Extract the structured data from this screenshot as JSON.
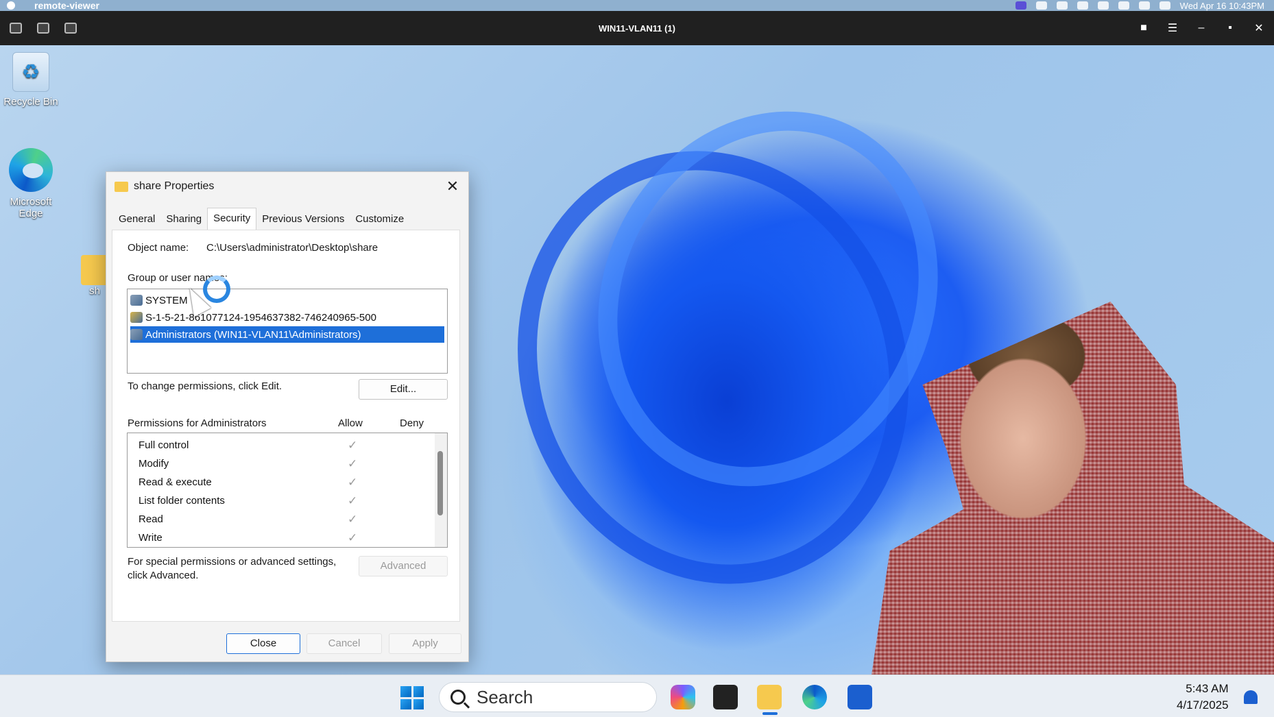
{
  "mac_bar": {
    "app_name": "remote-viewer",
    "datetime": "Wed Apr 16  10:43PM"
  },
  "viewer": {
    "title": "WIN11-VLAN11 (1)"
  },
  "desktop": {
    "icons": [
      {
        "label": "Recycle Bin"
      },
      {
        "label": "Microsoft Edge"
      },
      {
        "label": "sh"
      }
    ]
  },
  "dialog": {
    "title": "share Properties",
    "tabs": [
      "General",
      "Sharing",
      "Security",
      "Previous Versions",
      "Customize"
    ],
    "active_tab": "Security",
    "object_name_label": "Object name:",
    "object_name_value": "C:\\Users\\administrator\\Desktop\\share",
    "group_label": "Group or user names:",
    "users": [
      {
        "name": "SYSTEM",
        "selected": false
      },
      {
        "name": "S-1-5-21-861077124-1954637382-746240965-500",
        "selected": false
      },
      {
        "name": "Administrators (WIN11-VLAN11\\Administrators)",
        "selected": true
      }
    ],
    "change_text": "To change permissions, click Edit.",
    "edit_button": "Edit...",
    "permissions_for": "Permissions for Administrators",
    "allow_header": "Allow",
    "deny_header": "Deny",
    "permissions": [
      {
        "name": "Full control",
        "allow": true,
        "deny": false
      },
      {
        "name": "Modify",
        "allow": true,
        "deny": false
      },
      {
        "name": "Read & execute",
        "allow": true,
        "deny": false
      },
      {
        "name": "List folder contents",
        "allow": true,
        "deny": false
      },
      {
        "name": "Read",
        "allow": true,
        "deny": false
      },
      {
        "name": "Write",
        "allow": true,
        "deny": false
      }
    ],
    "check_glyph": "✓",
    "special_text_1": "For special permissions or advanced settings,",
    "special_text_2": "click Advanced.",
    "advanced_button": "Advanced",
    "close_button": "Close",
    "cancel_button": "Cancel",
    "apply_button": "Apply"
  },
  "taskbar": {
    "search_label": "Search",
    "time": "5:43 AM",
    "date": "4/17/2025"
  }
}
